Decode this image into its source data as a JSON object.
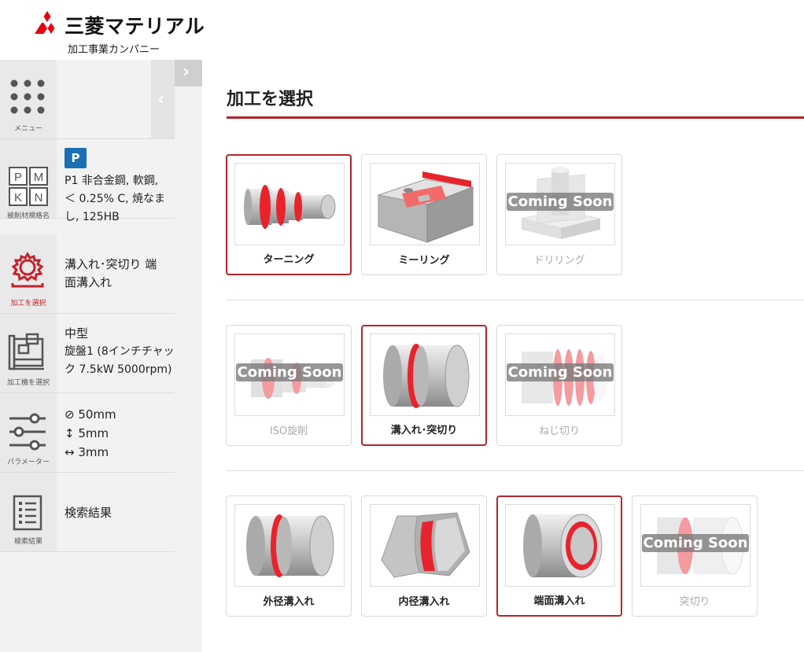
{
  "header": {
    "brand": "三菱マテリアル",
    "subtitle": "加工事業カンパニー",
    "brand_color": "#e60012"
  },
  "sidebar": {
    "menu": {
      "icon": "grid-dots-icon",
      "label": "メニュー"
    },
    "material": {
      "icon": "pmk-grid-icon",
      "grid": [
        "P",
        "M",
        "K",
        "N"
      ],
      "label": "被削材規格名",
      "badge": "P",
      "badge_color": "#1a6fb5",
      "text": [
        "P1 非合金鋼, 軟鋼,",
        "＜ 0.25% C, 焼なま",
        "し, 125HB"
      ]
    },
    "process": {
      "icon": "gear-tool-icon",
      "label": "加工を選択",
      "active_color": "#c5202a",
      "text": [
        "溝入れ･突切り 端",
        "面溝入れ"
      ]
    },
    "machine": {
      "icon": "lathe-icon",
      "label": "加工機を選択",
      "text": [
        "中型",
        "旋盤1 (8インチチャッ",
        "ク 7.5kW 5000rpm)"
      ]
    },
    "parameters": {
      "icon": "sliders-icon",
      "label": "パラメーター",
      "text": [
        "⊘ 50mm",
        "↕ 5mm",
        "↔ 3mm"
      ]
    },
    "results": {
      "icon": "list-doc-icon",
      "label": "検索結果",
      "text": "検索結果"
    }
  },
  "main": {
    "title": "加工を選択",
    "accent_color": "#b3262c",
    "coming_soon": "Coming Soon",
    "row1": [
      {
        "label": "ターニング",
        "state": "selected",
        "icon": "turning-part-icon"
      },
      {
        "label": "ミーリング",
        "state": "normal",
        "icon": "milling-block-icon"
      },
      {
        "label": "ドリリング",
        "state": "disabled",
        "icon": "drilling-part-icon"
      }
    ],
    "row2": [
      {
        "label": "ISO旋削",
        "state": "disabled",
        "icon": "iso-turning-icon"
      },
      {
        "label": "溝入れ･突切り",
        "state": "selected",
        "icon": "grooving-icon"
      },
      {
        "label": "ねじ切り",
        "state": "disabled",
        "icon": "threading-icon"
      }
    ],
    "row3": [
      {
        "label": "外径溝入れ",
        "state": "normal",
        "icon": "external-groove-icon"
      },
      {
        "label": "内径溝入れ",
        "state": "normal",
        "icon": "internal-groove-icon"
      },
      {
        "label": "端面溝入れ",
        "state": "selected",
        "icon": "face-groove-icon"
      },
      {
        "label": "突切り",
        "state": "disabled",
        "icon": "parting-off-icon"
      }
    ]
  }
}
